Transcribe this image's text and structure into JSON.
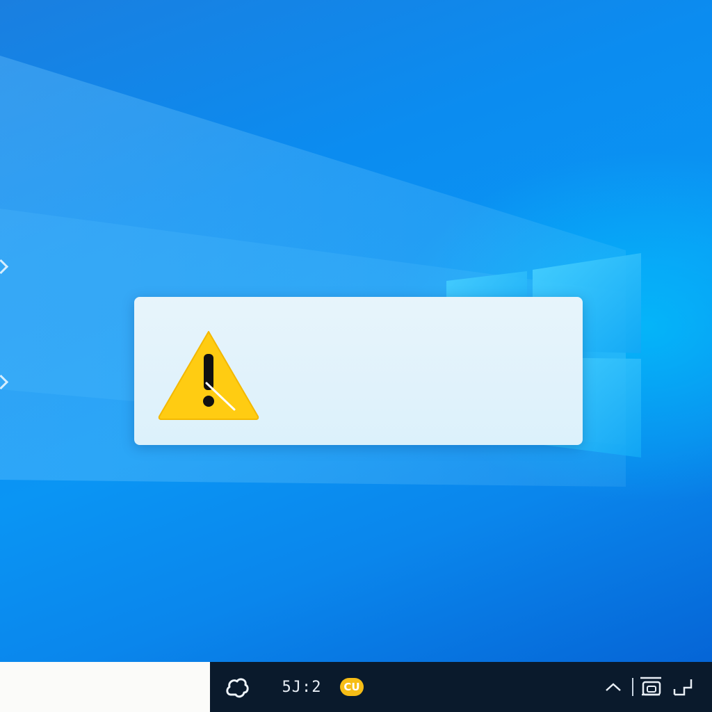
{
  "notification": {
    "icon": "warning-icon",
    "line1": "",
    "line2": ""
  },
  "taskbar": {
    "start_icon": "cloud-icon",
    "clock": "5J:2",
    "badge": "CU",
    "tray_icons": [
      "chevron-up-icon",
      "network-icon",
      "display-icon"
    ]
  },
  "colors": {
    "desktop_blue": "#0a95f4",
    "taskbar": "#0a1a2c",
    "warning_yellow": "#ffcc12",
    "notification_bg": "#e2f3fb"
  }
}
